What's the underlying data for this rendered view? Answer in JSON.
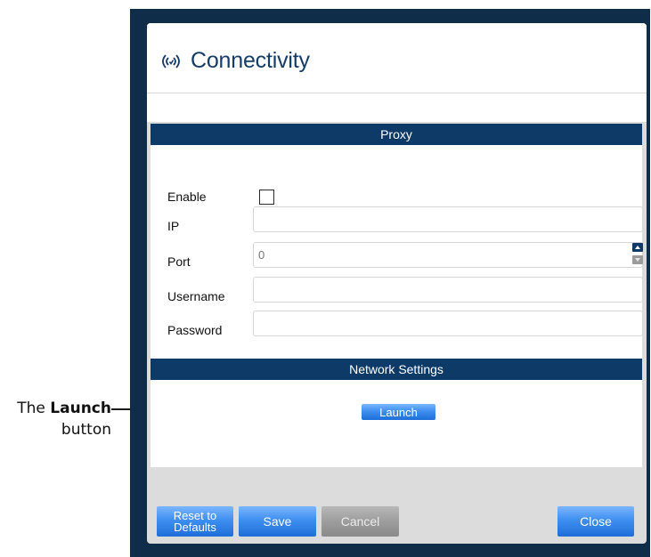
{
  "dialog": {
    "title": "Connectivity",
    "icon": "wireless-signal-icon"
  },
  "proxy": {
    "section_title": "Proxy",
    "fields": {
      "enable_label": "Enable",
      "enable_checked": false,
      "ip_label": "IP",
      "ip_value": "",
      "port_label": "Port",
      "port_placeholder": "0",
      "username_label": "Username",
      "username_value": "",
      "password_label": "Password",
      "password_value": ""
    }
  },
  "network": {
    "section_title": "Network Settings",
    "launch_label": "Launch"
  },
  "footer": {
    "reset_label_line1": "Reset to",
    "reset_label_line2": "Defaults",
    "save_label": "Save",
    "cancel_label": "Cancel",
    "close_label": "Close"
  },
  "annotation": {
    "prefix": "The ",
    "bold": "Launch",
    "suffix": "button"
  },
  "colors": {
    "frame": "#0f2c48",
    "section_header": "#0e3a68",
    "title": "#163c68",
    "button_blue": "#3f8ff0",
    "button_disabled": "#9d9d9d"
  }
}
